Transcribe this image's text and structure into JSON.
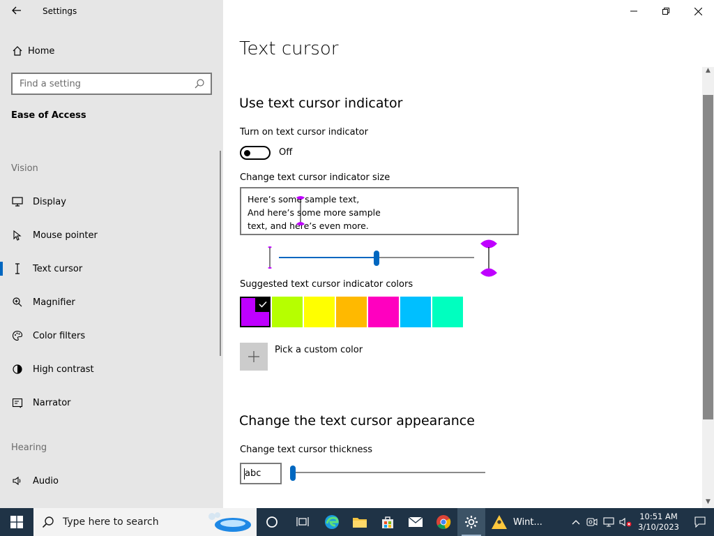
{
  "window": {
    "title": "Settings",
    "back_label": "←"
  },
  "sidebar": {
    "home_label": "Home",
    "search_placeholder": "Find a setting",
    "section": "Ease of Access",
    "vision_label": "Vision",
    "vision_items": [
      {
        "label": "Display",
        "icon": "monitor-icon"
      },
      {
        "label": "Mouse pointer",
        "icon": "mouse-pointer-icon"
      },
      {
        "label": "Text cursor",
        "icon": "text-cursor-icon",
        "selected": true
      },
      {
        "label": "Magnifier",
        "icon": "magnifier-icon"
      },
      {
        "label": "Color filters",
        "icon": "color-filters-icon"
      },
      {
        "label": "High contrast",
        "icon": "high-contrast-icon"
      },
      {
        "label": "Narrator",
        "icon": "narrator-icon"
      }
    ],
    "hearing_label": "Hearing",
    "hearing_items": [
      {
        "label": "Audio",
        "icon": "audio-icon"
      }
    ]
  },
  "main": {
    "title": "Text cursor",
    "indicator_heading": "Use text cursor indicator",
    "toggle_label": "Turn on text cursor indicator",
    "toggle_state": "Off",
    "size_label": "Change text cursor indicator size",
    "preview_lines": [
      "Here’s some sample text,",
      "And here’s some more sample",
      "text, and here’s even more."
    ],
    "size_slider_value": 0.5,
    "colors_label": "Suggested text cursor indicator colors",
    "colors": [
      "#bf00ff",
      "#b6ff00",
      "#ffff00",
      "#ffb900",
      "#ff00bf",
      "#00bfff",
      "#00ffbf"
    ],
    "selected_color_index": 0,
    "custom_color_label": "Pick a custom color",
    "appearance_heading": "Change the text cursor appearance",
    "thickness_label": "Change text cursor thickness",
    "thickness_preview": "abc",
    "thickness_slider_value": 0.0
  },
  "taskbar": {
    "search_placeholder": "Type here to search",
    "weather_label": "Wint...",
    "time": "10:51 AM",
    "date": "3/10/2023"
  },
  "accent_color": "#0067c0"
}
